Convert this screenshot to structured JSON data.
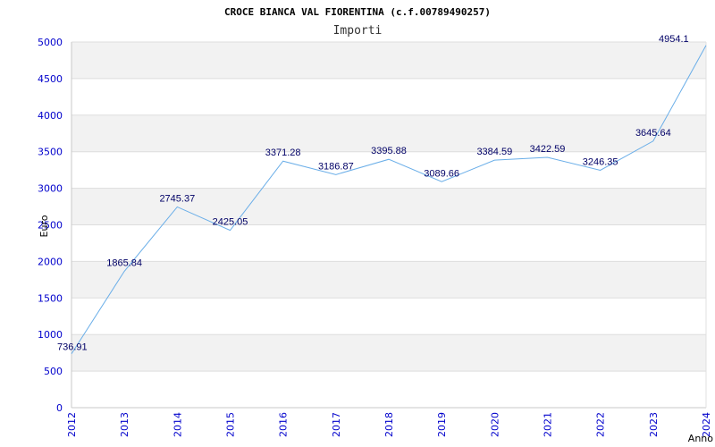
{
  "chart_data": {
    "type": "line",
    "title": "CROCE BIANCA VAL FIORENTINA (c.f.00789490257)",
    "subtitle": "Importi",
    "xlabel": "Anno",
    "ylabel": "Euro",
    "ylim": [
      0,
      5000
    ],
    "yticks": [
      "0",
      "500",
      "1000",
      "1500",
      "2000",
      "2500",
      "3000",
      "3500",
      "4000",
      "4500",
      "5000"
    ],
    "categories": [
      "2012",
      "2013",
      "2014",
      "2015",
      "2016",
      "2017",
      "2018",
      "2019",
      "2020",
      "2021",
      "2022",
      "2023",
      "2024"
    ],
    "values": [
      736.91,
      1865.84,
      2745.37,
      2425.05,
      3371.28,
      3186.87,
      3395.88,
      3089.66,
      3384.59,
      3422.59,
      3246.35,
      3645.64,
      4954.1
    ],
    "data_labels": [
      "736.91",
      "1865.84",
      "2745.37",
      "2425.05",
      "3371.28",
      "3186.87",
      "3395.88",
      "3089.66",
      "3384.59",
      "3422.59",
      "3246.35",
      "3645.64",
      "4954.1"
    ],
    "grid": true,
    "colors": {
      "line": "#6aaee8",
      "band": "#f2f2f2",
      "grid": "#dddddd",
      "tick_text": "#0000cc",
      "data_label": "#000066"
    }
  }
}
